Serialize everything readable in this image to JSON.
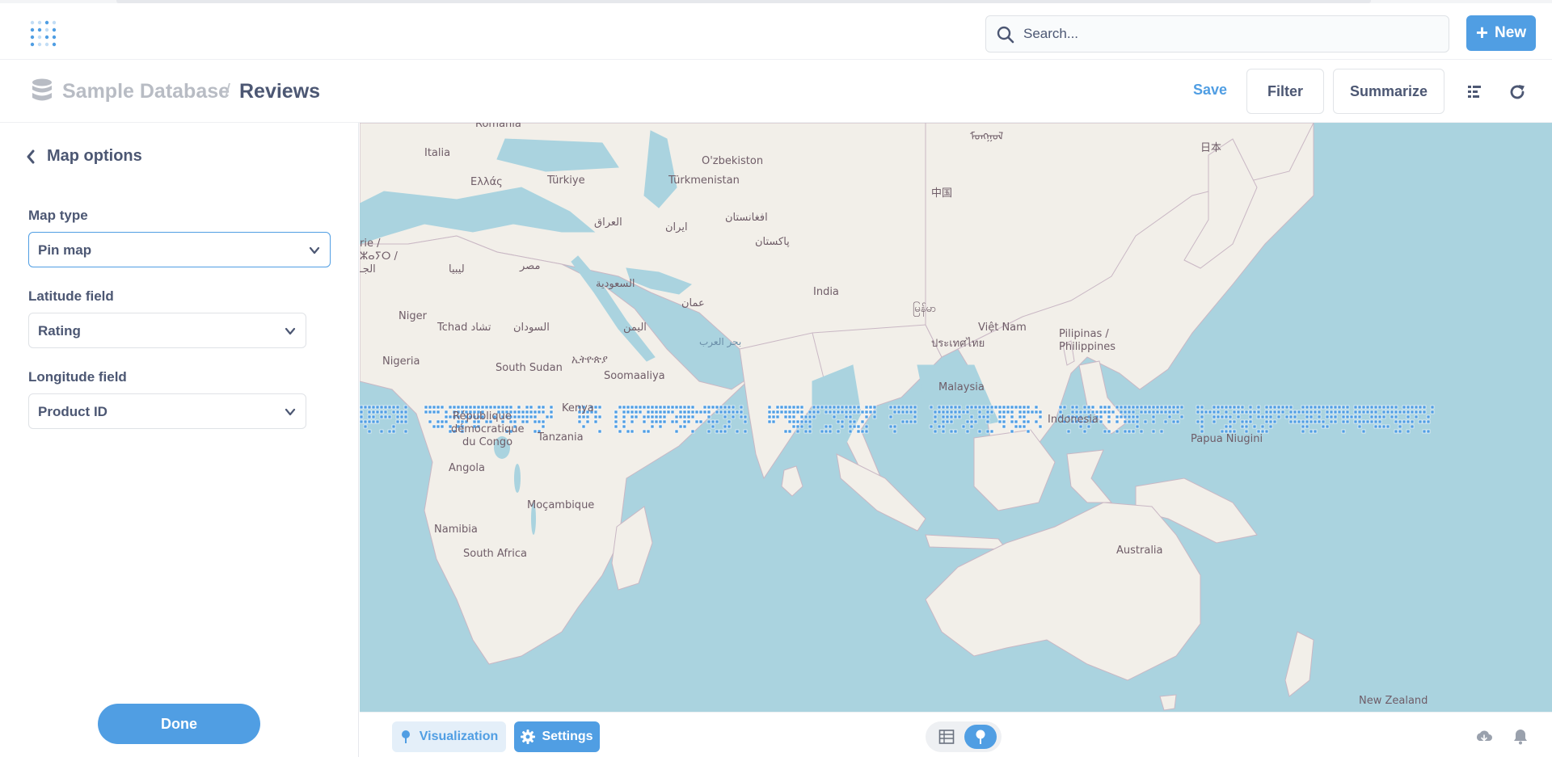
{
  "nav": {
    "search_placeholder": "Search...",
    "new_label": "New",
    "accent": "#509ee3"
  },
  "header": {
    "database": "Sample Database",
    "separator": "/",
    "title": "Reviews",
    "save_label": "Save",
    "filter_label": "Filter",
    "summarize_label": "Summarize"
  },
  "sidebar": {
    "back_label": "Map options",
    "map_type_label": "Map type",
    "map_type_value": "Pin map",
    "latitude_label": "Latitude field",
    "latitude_value": "Rating",
    "longitude_label": "Longitude field",
    "longitude_value": "Product ID",
    "done_label": "Done"
  },
  "map": {
    "labels": {
      "romania": "Romania",
      "italia": "Italia",
      "ellas": "Ελλάς",
      "turkiye": "Türkiye",
      "ozbekiston": "O'zbekiston",
      "turkmenistan": "Türkmenistan",
      "china": "中国",
      "japan": "日本",
      "mongolia": "ᠮᠣᠩᠭᠣᠯ",
      "algerie1": "rie /",
      "algerie2": "ⵣⴰⵢⵔ /",
      "algerie3": "الجـ",
      "iraq": "العراق",
      "iran": "ایران",
      "afghanistan": "افغانستان",
      "pakistan": "پاکستان",
      "libya": "ليبيا",
      "egypt": "مصر",
      "saudi": "السعودية",
      "india": "India",
      "oman": "عمان",
      "myanmar": "မြန်မာ",
      "vietnam": "Việt Nam",
      "philippines1": "Pilipinas /",
      "philippines2": "Philippines",
      "niger": "Niger",
      "tchad": "Tchad تشاد",
      "sudan": "السودان",
      "yemen": "اليمن",
      "arabsea": "بحر العرب",
      "thailand": "ประเทศไทย",
      "nigeria": "Nigeria",
      "southsudan": "South Sudan",
      "ethiopia": "ኢትዮጵያ",
      "somalia": "Soomaaliya",
      "kenya": "Kenya",
      "malaysia": "Malaysia",
      "indonesia": "Indonesia",
      "drc1": "République",
      "drc2": "démocratique",
      "drc3": "du Congo",
      "tanzania": "Tanzania",
      "png": "Papua Niugini",
      "angola": "Angola",
      "mozambique": "Moçambique",
      "namibia": "Namibia",
      "southafrica": "South Africa",
      "australia": "Australia",
      "newzealand": "New Zealand"
    }
  },
  "footer": {
    "visualization_label": "Visualization",
    "settings_label": "Settings"
  }
}
